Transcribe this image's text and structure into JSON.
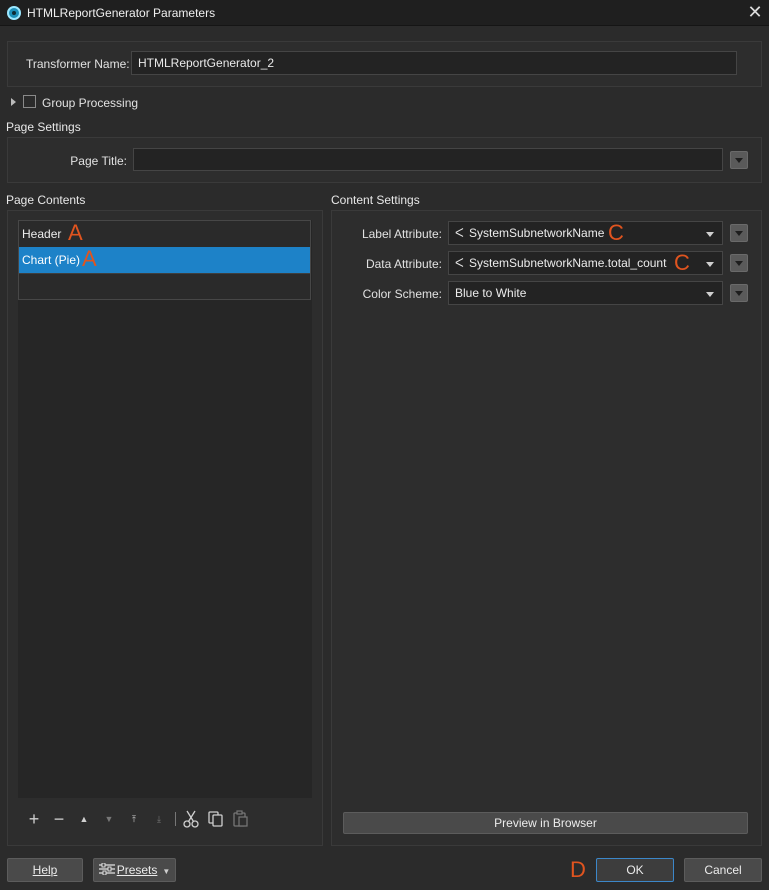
{
  "window": {
    "title": "HTMLReportGenerator Parameters",
    "close_glyph": "✕"
  },
  "transformer": {
    "label": "Transformer Name:",
    "value": "HTMLReportGenerator_2"
  },
  "group_processing": {
    "label": "Group Processing",
    "checked": false
  },
  "page_settings": {
    "title": "Page Settings",
    "page_title_label": "Page Title:",
    "page_title_value": ""
  },
  "page_contents": {
    "title": "Page Contents",
    "items": [
      {
        "label": "Header",
        "marker": "A",
        "selected": false
      },
      {
        "label": "Chart (Pie)",
        "marker": "A",
        "selected": true
      }
    ],
    "toolbar": [
      "add-icon",
      "remove-icon",
      "move-up-icon",
      "move-down-icon",
      "move-top-icon",
      "move-bottom-icon",
      "cut-icon",
      "copy-icon",
      "paste-icon"
    ]
  },
  "content_settings": {
    "title": "Content Settings",
    "label_attribute": {
      "label": "Label Attribute:",
      "value": "SystemSubnetworkName",
      "marker": "C"
    },
    "data_attribute": {
      "label": "Data Attribute:",
      "value": "SystemSubnetworkName.total_count",
      "marker": "C"
    },
    "color_scheme": {
      "label": "Color Scheme:",
      "value": "Blue to White"
    },
    "preview_button": "Preview in Browser"
  },
  "footer": {
    "help": "Help",
    "presets": "Presets",
    "ok_marker": "D",
    "ok": "OK",
    "cancel": "Cancel"
  },
  "colors": {
    "selection": "#1d82c8",
    "annotation": "#e0541f",
    "ok_border": "#3c87c9"
  }
}
